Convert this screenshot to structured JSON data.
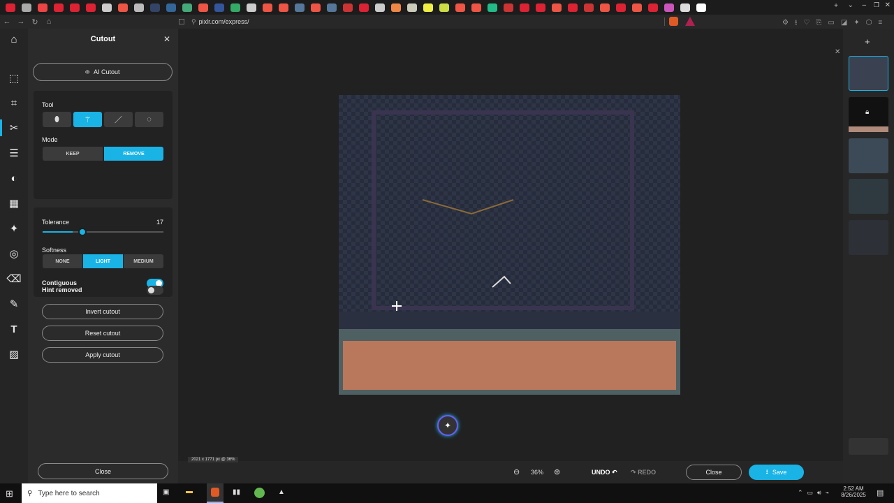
{
  "browser": {
    "url": "pixlr.com/express/",
    "tab_favicons": [
      "#d23",
      "#aaa",
      "#e44",
      "#d23",
      "#d23",
      "#d23",
      "#ccc",
      "#e54",
      "#bbb",
      "#346",
      "#369",
      "#4a7",
      "#e54",
      "#359",
      "#3a6",
      "#ccc",
      "#e54",
      "#e54",
      "#579",
      "#e54",
      "#579",
      "#c33",
      "#d23",
      "#ccc",
      "#e84",
      "#ccb",
      "#ee4",
      "#cd4",
      "#e54",
      "#e54",
      "#2b8",
      "#c33",
      "#d23",
      "#d23",
      "#e54",
      "#d23",
      "#c33",
      "#e54",
      "#d23",
      "#e54",
      "#d23",
      "#c5b",
      "#ddd",
      "#fff"
    ]
  },
  "rail": {
    "icons": [
      "home-icon",
      "select-arrow-icon",
      "crop-icon",
      "scissors-icon",
      "adjust-sliders-icon",
      "contrast-icon",
      "filter-grid-icon",
      "sparkle-icon",
      "spiral-icon",
      "eraser-icon",
      "brush-icon",
      "text-icon",
      "hatch-icon"
    ]
  },
  "panel": {
    "title": "Cutout",
    "ai_cutout": "AI Cutout",
    "tool_label": "Tool",
    "mode_label": "Mode",
    "mode_keep": "KEEP",
    "mode_remove": "REMOVE",
    "tolerance_label": "Tolerance",
    "tolerance_value": "17",
    "tolerance_fraction": 0.17,
    "softness_label": "Softness",
    "soft_none": "NONE",
    "soft_light": "LIGHT",
    "soft_medium": "MEDIUM",
    "contiguous_label": "Contiguous",
    "contiguous_on": true,
    "hint_label": "Hint removed",
    "hint_on": false,
    "invert": "Invert cutout",
    "reset": "Reset cutout",
    "apply": "Apply cutout",
    "close": "Close"
  },
  "canvas": {
    "dims": "2021 x 1771 px @ 36%"
  },
  "bottom": {
    "zoom": "36%",
    "undo": "UNDO",
    "redo": "REDO",
    "close": "Close",
    "save": "Save"
  },
  "taskbar": {
    "search_placeholder": "Type here to search",
    "time": "2:52 AM",
    "date": "8/26/2025"
  },
  "colors": {
    "accent": "#19b3e6",
    "floor": "#b9775c"
  }
}
